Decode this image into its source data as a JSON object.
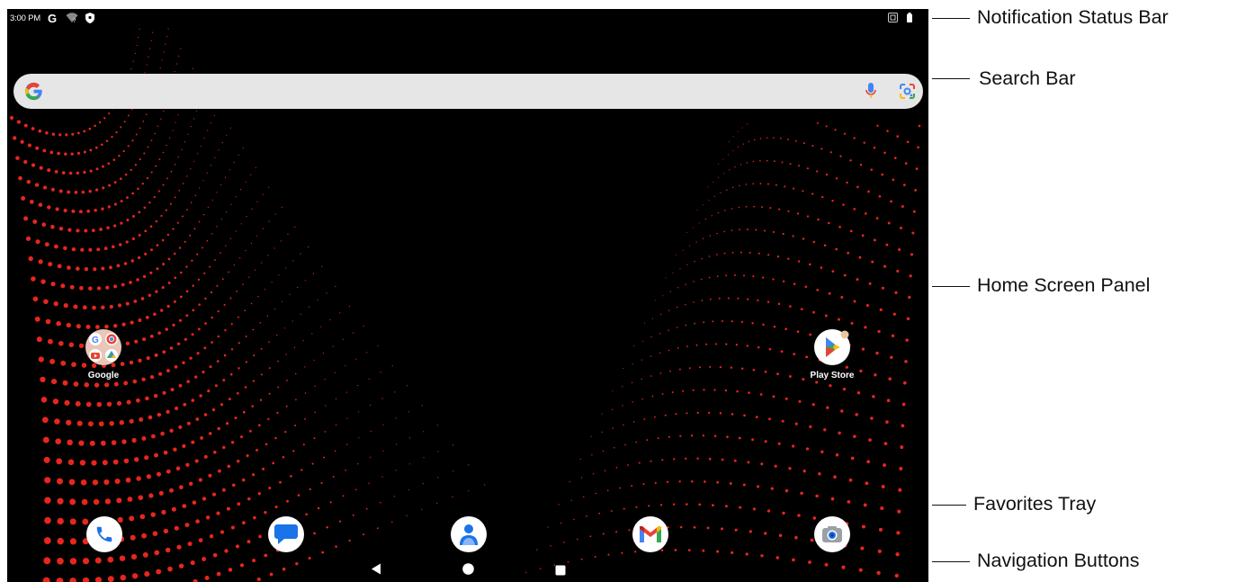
{
  "status_bar": {
    "time": "3:00 PM",
    "left_icons": [
      "google-g-icon",
      "wifi-icon",
      "shield-icon"
    ],
    "right_icons": [
      "nfc-icon",
      "battery-icon"
    ]
  },
  "search_bar": {
    "icons": [
      "google-logo-icon",
      "microphone-icon",
      "google-lens-icon"
    ]
  },
  "home_apps": [
    {
      "label": "Google",
      "kind": "folder"
    },
    {
      "label": "Play Store",
      "kind": "app"
    }
  ],
  "favorites": [
    "phone-icon",
    "messages-icon",
    "contacts-icon",
    "gmail-icon",
    "camera-icon"
  ],
  "navigation": [
    "back-button",
    "home-button",
    "recents-button"
  ],
  "callouts": {
    "notification_status_bar": "Notification Status Bar",
    "search_bar": "Search Bar",
    "home_screen_panel": "Home Screen Panel",
    "favorites_tray": "Favorites Tray",
    "navigation_buttons": "Navigation Buttons"
  },
  "colors": {
    "wallpaper_background": "#000000",
    "wallpaper_dots": "#e8261c",
    "search_bar": "#e6e6e6",
    "google_blue": "#4285f4",
    "google_red": "#ea4335",
    "google_yellow": "#fbbc05",
    "google_green": "#34a853"
  }
}
